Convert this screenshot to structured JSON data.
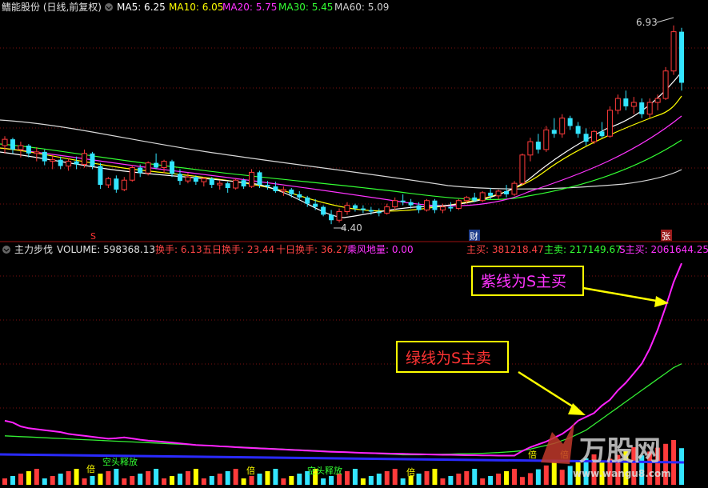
{
  "top_legend": {
    "stock": "鳍能股份 (日线,前复权)",
    "ma": [
      {
        "label": "MA5: 6.25",
        "color": "#ffffff"
      },
      {
        "label": "MA10: 6.05",
        "color": "#ffff00"
      },
      {
        "label": "MA20: 5.75",
        "color": "#ff33ff"
      },
      {
        "label": "MA30: 5.45",
        "color": "#33ff33"
      },
      {
        "label": "MA60: 5.09",
        "color": "#d0d0d0"
      }
    ]
  },
  "price_panel": {
    "high_label": "6.93",
    "low_label": "4.40",
    "markers": {
      "s": "S",
      "cai": "财",
      "zhang": "张"
    }
  },
  "bottom_legend": {
    "name": "主力步伐",
    "volume": "VOLUME: 598368.13",
    "items": [
      {
        "label": "换手: 6.13",
        "color": "#ff4444"
      },
      {
        "label": "五日换手: 23.44",
        "color": "#ff4444"
      },
      {
        "label": "十日换手: 36.27",
        "color": "#ff4444"
      },
      {
        "label": "乘风地量: 0.00",
        "color": "#ff33ff"
      }
    ],
    "right": [
      {
        "label": "主买: 381218.47",
        "color": "#ff4444"
      },
      {
        "label": "主卖: 217149.67",
        "color": "#33ff33"
      },
      {
        "label": "S主买: 2061644.25",
        "color": "#ff33ff"
      }
    ]
  },
  "annotations": {
    "purple_line": "紫线为S主买",
    "green_line": "绿线为S主卖"
  },
  "lower_texts": {
    "kongtou1": "空头释放",
    "kongtou2": "空头释放",
    "bei": "倍"
  },
  "watermark": {
    "brand": "万股网",
    "url": "www.wangu8.com"
  },
  "chart_data": {
    "type": "candlestick",
    "price_high": 6.93,
    "price_low": 4.4,
    "candles": [
      [
        5.4,
        5.52,
        5.3,
        5.48
      ],
      [
        5.48,
        5.5,
        5.3,
        5.35
      ],
      [
        5.35,
        5.45,
        5.25,
        5.4
      ],
      [
        5.4,
        5.42,
        5.25,
        5.3
      ],
      [
        5.3,
        5.38,
        5.2,
        5.32
      ],
      [
        5.32,
        5.35,
        5.15,
        5.2
      ],
      [
        5.2,
        5.28,
        5.1,
        5.22
      ],
      [
        5.22,
        5.26,
        5.1,
        5.14
      ],
      [
        5.14,
        5.24,
        5.08,
        5.2
      ],
      [
        5.2,
        5.26,
        5.1,
        5.16
      ],
      [
        5.16,
        5.35,
        5.12,
        5.3
      ],
      [
        5.3,
        5.32,
        5.1,
        5.14
      ],
      [
        5.14,
        5.18,
        4.85,
        4.9
      ],
      [
        4.9,
        5.0,
        4.86,
        4.98
      ],
      [
        4.98,
        5.02,
        4.8,
        4.84
      ],
      [
        4.84,
        5.0,
        4.82,
        4.96
      ],
      [
        4.96,
        5.15,
        4.94,
        5.12
      ],
      [
        5.12,
        5.16,
        5.0,
        5.05
      ],
      [
        5.05,
        5.2,
        5.02,
        5.18
      ],
      [
        5.18,
        5.3,
        5.1,
        5.12
      ],
      [
        5.12,
        5.22,
        5.05,
        5.2
      ],
      [
        5.2,
        5.22,
        5.0,
        5.04
      ],
      [
        5.04,
        5.1,
        4.9,
        4.95
      ],
      [
        4.95,
        5.05,
        4.92,
        5.0
      ],
      [
        5.0,
        5.02,
        4.9,
        4.94
      ],
      [
        4.94,
        5.0,
        4.88,
        4.98
      ],
      [
        4.98,
        5.0,
        4.86,
        4.9
      ],
      [
        4.9,
        4.96,
        4.84,
        4.92
      ],
      [
        4.92,
        4.94,
        4.8,
        4.86
      ],
      [
        4.86,
        4.98,
        4.84,
        4.96
      ],
      [
        4.96,
        4.98,
        4.85,
        4.88
      ],
      [
        4.88,
        5.1,
        4.86,
        5.06
      ],
      [
        5.06,
        5.08,
        4.86,
        4.9
      ],
      [
        4.9,
        4.95,
        4.84,
        4.88
      ],
      [
        4.88,
        4.94,
        4.8,
        4.82
      ],
      [
        4.82,
        4.88,
        4.76,
        4.84
      ],
      [
        4.84,
        4.86,
        4.74,
        4.78
      ],
      [
        4.78,
        4.82,
        4.7,
        4.74
      ],
      [
        4.74,
        4.76,
        4.62,
        4.66
      ],
      [
        4.66,
        4.72,
        4.58,
        4.62
      ],
      [
        4.62,
        4.64,
        4.5,
        4.52
      ],
      [
        4.52,
        4.58,
        4.4,
        4.45
      ],
      [
        4.45,
        4.6,
        4.42,
        4.56
      ],
      [
        4.56,
        4.68,
        4.52,
        4.64
      ],
      [
        4.64,
        4.66,
        4.56,
        4.6
      ],
      [
        4.6,
        4.64,
        4.54,
        4.58
      ],
      [
        4.58,
        4.62,
        4.52,
        4.56
      ],
      [
        4.56,
        4.6,
        4.5,
        4.54
      ],
      [
        4.54,
        4.66,
        4.52,
        4.62
      ],
      [
        4.62,
        4.74,
        4.58,
        4.7
      ],
      [
        4.7,
        4.78,
        4.64,
        4.68
      ],
      [
        4.68,
        4.72,
        4.6,
        4.64
      ],
      [
        4.64,
        4.68,
        4.54,
        4.58
      ],
      [
        4.58,
        4.72,
        4.56,
        4.7
      ],
      [
        4.7,
        4.72,
        4.54,
        4.58
      ],
      [
        4.58,
        4.66,
        4.54,
        4.62
      ],
      [
        4.62,
        4.68,
        4.56,
        4.6
      ],
      [
        4.6,
        4.72,
        4.58,
        4.7
      ],
      [
        4.7,
        4.76,
        4.66,
        4.74
      ],
      [
        4.74,
        4.8,
        4.68,
        4.7
      ],
      [
        4.7,
        4.82,
        4.68,
        4.8
      ],
      [
        4.8,
        4.86,
        4.72,
        4.76
      ],
      [
        4.76,
        4.84,
        4.72,
        4.82
      ],
      [
        4.82,
        4.9,
        4.74,
        4.78
      ],
      [
        4.78,
        4.95,
        4.76,
        4.92
      ],
      [
        4.92,
        5.3,
        4.9,
        5.28
      ],
      [
        5.28,
        5.5,
        5.2,
        5.45
      ],
      [
        5.45,
        5.55,
        5.3,
        5.35
      ],
      [
        5.35,
        5.65,
        5.32,
        5.6
      ],
      [
        5.6,
        5.75,
        5.5,
        5.55
      ],
      [
        5.55,
        5.8,
        5.5,
        5.75
      ],
      [
        5.75,
        5.78,
        5.6,
        5.65
      ],
      [
        5.65,
        5.7,
        5.5,
        5.55
      ],
      [
        5.55,
        5.62,
        5.4,
        5.45
      ],
      [
        5.45,
        5.6,
        5.42,
        5.58
      ],
      [
        5.58,
        5.7,
        5.5,
        5.52
      ],
      [
        5.52,
        5.9,
        5.5,
        5.85
      ],
      [
        5.85,
        6.05,
        5.8,
        6.0
      ],
      [
        6.0,
        6.1,
        5.85,
        5.9
      ],
      [
        5.9,
        6.02,
        5.8,
        5.95
      ],
      [
        5.95,
        6.0,
        5.75,
        5.8
      ],
      [
        5.8,
        6.0,
        5.75,
        5.95
      ],
      [
        5.95,
        6.05,
        5.85,
        6.0
      ],
      [
        6.0,
        6.4,
        5.98,
        6.35
      ],
      [
        6.35,
        6.93,
        6.3,
        6.85
      ],
      [
        6.85,
        6.9,
        6.1,
        6.2
      ]
    ],
    "s_main_buy": [
      220,
      210,
      190,
      180,
      175,
      170,
      165,
      160,
      150,
      145,
      140,
      135,
      130,
      125,
      128,
      132,
      126,
      120,
      115,
      112,
      108,
      104,
      100,
      96,
      92,
      90,
      88,
      85,
      83,
      80,
      78,
      76,
      74,
      72,
      70,
      68,
      66,
      64,
      62,
      60,
      58,
      56,
      55,
      54,
      52,
      50,
      49,
      48,
      47,
      46,
      45,
      44,
      43,
      42,
      41,
      40,
      40,
      39,
      38,
      38,
      37,
      37,
      36,
      36,
      36,
      60,
      80,
      95,
      110,
      130,
      150,
      180,
      220,
      240,
      260,
      300,
      330,
      380,
      420,
      470,
      520,
      600,
      700,
      820,
      950,
      1050
    ],
    "s_main_sell": [
      140,
      138,
      136,
      134,
      132,
      130,
      128,
      126,
      124,
      122,
      120,
      118,
      116,
      114,
      112,
      110,
      108,
      106,
      104,
      102,
      100,
      98,
      96,
      94,
      92,
      90,
      88,
      86,
      84,
      82,
      80,
      78,
      76,
      74,
      72,
      70,
      68,
      66,
      64,
      62,
      60,
      58,
      56,
      54,
      52,
      50,
      48,
      46,
      44,
      42,
      40,
      40,
      40,
      41,
      42,
      43,
      44,
      45,
      46,
      47,
      48,
      50,
      52,
      55,
      58,
      62,
      70,
      80,
      90,
      100,
      115,
      130,
      150,
      170,
      200,
      230,
      260,
      290,
      320,
      350,
      380,
      410,
      440,
      470,
      500,
      520
    ]
  }
}
